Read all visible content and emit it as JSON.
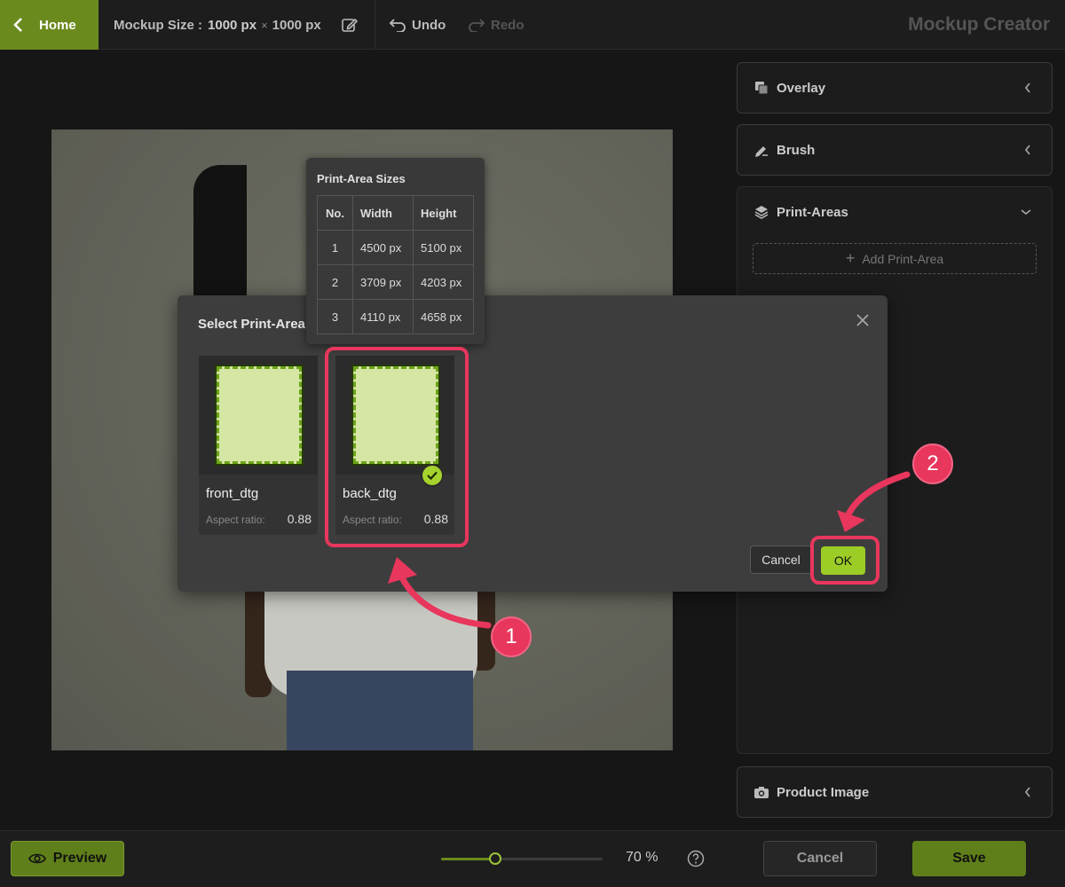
{
  "topbar": {
    "home_label": "Home",
    "mockup_size_label": "Mockup Size :",
    "mockup_width": "1000 px",
    "mockup_x": "×",
    "mockup_height": "1000 px",
    "undo_label": "Undo",
    "redo_label": "Redo",
    "app_title": "Mockup Creator"
  },
  "panel": {
    "overlay_label": "Overlay",
    "brush_label": "Brush",
    "print_areas_label": "Print-Areas",
    "add_print_area_label": "Add Print-Area",
    "product_image_label": "Product Image"
  },
  "bottombar": {
    "preview_label": "Preview",
    "zoom_value": "70 %",
    "zoom_fraction": 0.35,
    "cancel_label": "Cancel",
    "save_label": "Save"
  },
  "modal": {
    "title": "Select Print-Area",
    "cards": [
      {
        "name": "front_dtg",
        "ar_label": "Aspect ratio:",
        "ar_value": "0.88",
        "selected": false
      },
      {
        "name": "back_dtg",
        "ar_label": "Aspect ratio:",
        "ar_value": "0.88",
        "selected": true
      }
    ],
    "cancel_label": "Cancel",
    "ok_label": "OK"
  },
  "tooltip": {
    "title": "Print-Area Sizes",
    "headers": [
      "No.",
      "Width",
      "Height"
    ],
    "rows": [
      [
        "1",
        "4500 px",
        "5100 px"
      ],
      [
        "2",
        "3709 px",
        "4203 px"
      ],
      [
        "3",
        "4110 px",
        "4658 px"
      ]
    ]
  },
  "annotations": {
    "badge_1": "1",
    "badge_2": "2",
    "highlight_color": "#e8365d"
  },
  "colors": {
    "accent": "#6b8a1e",
    "ok_green": "#9ccc26",
    "annotation": "#e8365d"
  }
}
